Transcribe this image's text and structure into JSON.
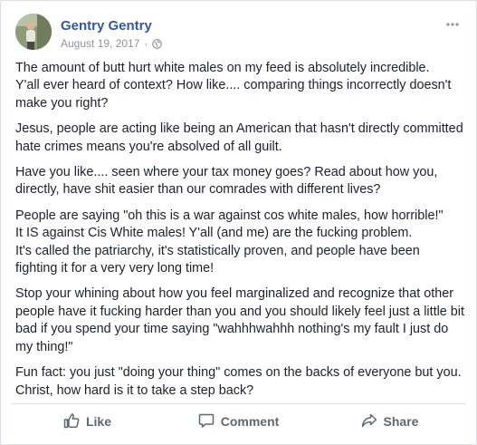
{
  "post": {
    "author": "Gentry Gentry",
    "date": "August 19, 2017",
    "separator": "·",
    "privacy_icon": "globe-icon",
    "paragraphs": [
      "The amount of butt hurt white males on my feed is absolutely incredible.\nY'all ever heard of context? How like.... comparing things incorrectly doesn't make you right?",
      "Jesus, people are acting like being an American that hasn't directly committed hate crimes means you're absolved of all guilt.",
      "Have you like.... seen where your tax money goes? Read about how you, directly, have shit easier than our comrades with different lives?",
      "People are saying \"oh this is a war against cos white males, how horrible!\"\nIt IS against Cis White males! Y'all (and me) are the fucking problem.\nIt's called the patriarchy, it's statistically proven, and people have been fighting it for a very very long time!",
      "Stop your whining about how you feel marginalized and recognize that other people have it fucking harder than you and you should likely feel just a little bit bad if you spend your time saying \"wahhhwahhh nothing's my fault I just do my thing!\"",
      "Fun fact: you just \"doing your thing\" comes on the backs of everyone but you. Christ, how hard is it to take a step back?"
    ]
  },
  "actions": {
    "like": "Like",
    "comment": "Comment",
    "share": "Share"
  },
  "colors": {
    "name_link": "#365899",
    "meta": "#90949c",
    "body_text": "#1d2129",
    "action_text": "#606770"
  }
}
